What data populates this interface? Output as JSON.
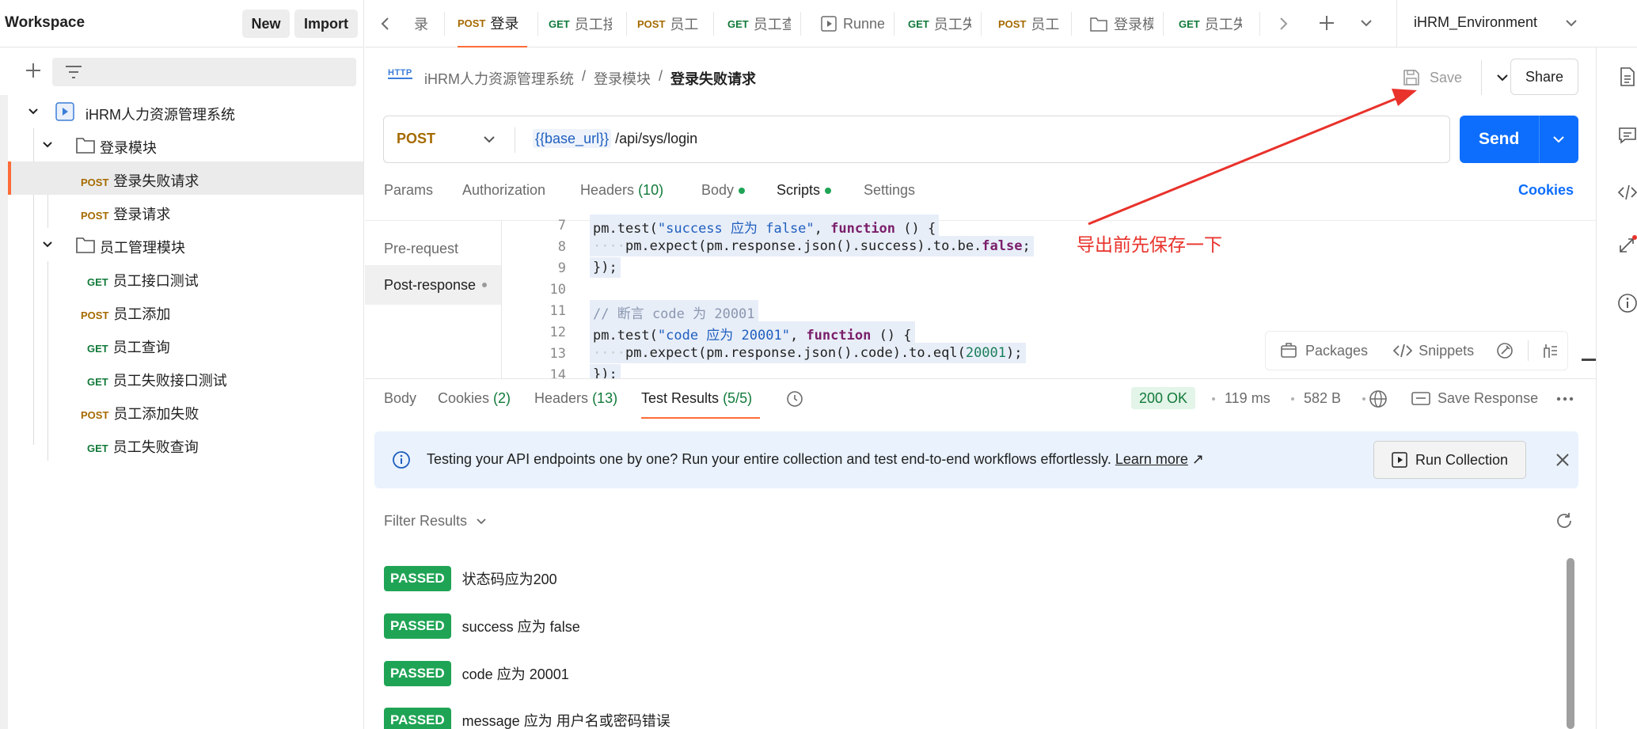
{
  "sidebar": {
    "workspace_title": "Workspace",
    "new_label": "New",
    "import_label": "Import",
    "tree": [
      {
        "label": "iHRM人力资源管理系统",
        "type": "collection"
      },
      {
        "label": "登录模块",
        "type": "folder"
      },
      {
        "method": "POST",
        "label": "登录失败请求",
        "active": true
      },
      {
        "method": "POST",
        "label": "登录请求"
      },
      {
        "label": "员工管理模块",
        "type": "folder"
      },
      {
        "method": "GET",
        "label": "员工接口测试"
      },
      {
        "method": "POST",
        "label": "员工添加"
      },
      {
        "method": "GET",
        "label": "员工查询"
      },
      {
        "method": "GET",
        "label": "员工失败接口测试"
      },
      {
        "method": "POST",
        "label": "员工添加失败"
      },
      {
        "method": "GET",
        "label": "员工失败查询"
      }
    ]
  },
  "tabs": [
    {
      "label": "录"
    },
    {
      "method": "POST",
      "label": "登录"
    },
    {
      "method": "GET",
      "label": "员工接"
    },
    {
      "method": "POST",
      "label": "员工"
    },
    {
      "method": "GET",
      "label": "员工查"
    },
    {
      "label": "Runne"
    },
    {
      "method": "GET",
      "label": "员工失"
    },
    {
      "method": "POST",
      "label": "员工"
    },
    {
      "label": "登录模"
    },
    {
      "method": "GET",
      "label": "员工失"
    }
  ],
  "environment": "iHRM_Environment",
  "request": {
    "breadcrumb": [
      "iHRM人力资源管理系统",
      "登录模块",
      "登录失败请求"
    ],
    "save_label": "Save",
    "share_label": "Share",
    "method": "POST",
    "url_var": "{{base_url}}",
    "url_path": "/api/sys/login",
    "send_label": "Send",
    "cookies_label": "Cookies",
    "tabs": {
      "params": "Params",
      "authorization": "Authorization",
      "headers": "Headers",
      "headers_count": "(10)",
      "body": "Body",
      "scripts": "Scripts",
      "settings": "Settings"
    }
  },
  "scripts": {
    "pre_request": "Pre-request",
    "post_response": "Post-response",
    "tools": {
      "packages": "Packages",
      "snippets": "Snippets"
    },
    "lines": {
      "n7": "7",
      "n8": "8",
      "n9": "9",
      "n10": "10",
      "n11": "11",
      "n12": "12",
      "n13": "13",
      "n14": "14"
    }
  },
  "annotation": "导出前先保存一下",
  "response": {
    "tabs": {
      "body": "Body",
      "cookies": "Cookies",
      "cookies_count": "(2)",
      "headers": "Headers",
      "headers_count": "(13)",
      "test_results": "Test Results",
      "test_results_count": "(5/5)"
    },
    "status": "200 OK",
    "time": "119 ms",
    "size": "582 B",
    "save_response": "Save Response",
    "banner_text": "Testing your API endpoints one by one? Run your entire collection and test end-to-end workflows effortlessly.",
    "banner_link": "Learn more",
    "run_collection": "Run Collection",
    "filter_results": "Filter Results",
    "results": [
      {
        "status": "PASSED",
        "name": "状态码应为200"
      },
      {
        "status": "PASSED",
        "name": "success 应为 false"
      },
      {
        "status": "PASSED",
        "name": "code 应为 20001"
      },
      {
        "status": "PASSED",
        "name": "message 应为 用户名或密码错误"
      }
    ]
  },
  "colors": {
    "accent": "#ff6c37",
    "send": "#0d6efd",
    "passed": "#1fa455",
    "annotation": "#e8322b"
  }
}
